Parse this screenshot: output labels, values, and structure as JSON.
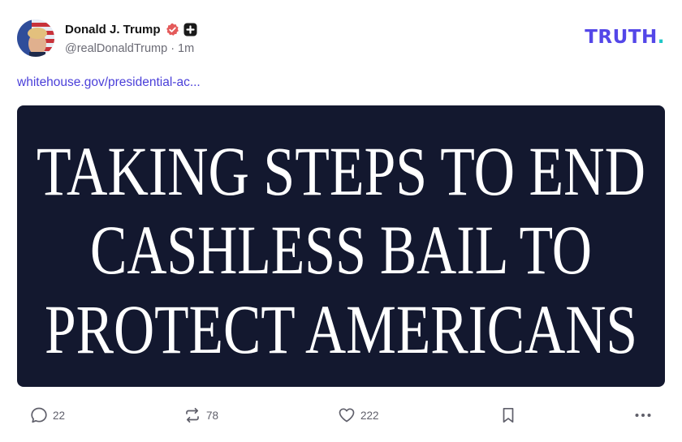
{
  "post": {
    "author": {
      "display_name": "Donald J. Trump",
      "handle": "@realDonaldTrump",
      "time": "1m",
      "separator": "·",
      "verified_icon": "verified-badge-icon",
      "plus_icon": "plus-badge-icon"
    },
    "logo": {
      "text": "TRUTH",
      "dot": "."
    },
    "link_text": "whitehouse.gov/presidential-ac...",
    "media": {
      "lines": [
        "TAKING STEPS TO END",
        "CASHLESS BAIL TO",
        "PROTECT AMERICANS"
      ],
      "background": "#13182f"
    },
    "actions": {
      "reply_count": "22",
      "retruth_count": "78",
      "like_count": "222"
    }
  },
  "colors": {
    "accent": "#5447e8",
    "link": "#4a3fd9",
    "verified": "#e45a5a",
    "logo_dot": "#1fc7c7"
  }
}
